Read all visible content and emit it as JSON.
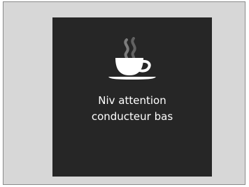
{
  "display": {
    "icon": "coffee-cup-icon",
    "message_line1": "Niv attention",
    "message_line2": "conducteur bas",
    "colors": {
      "frame_bg": "#d7d7d7",
      "screen_bg": "#262626",
      "text": "#ffffff"
    }
  }
}
